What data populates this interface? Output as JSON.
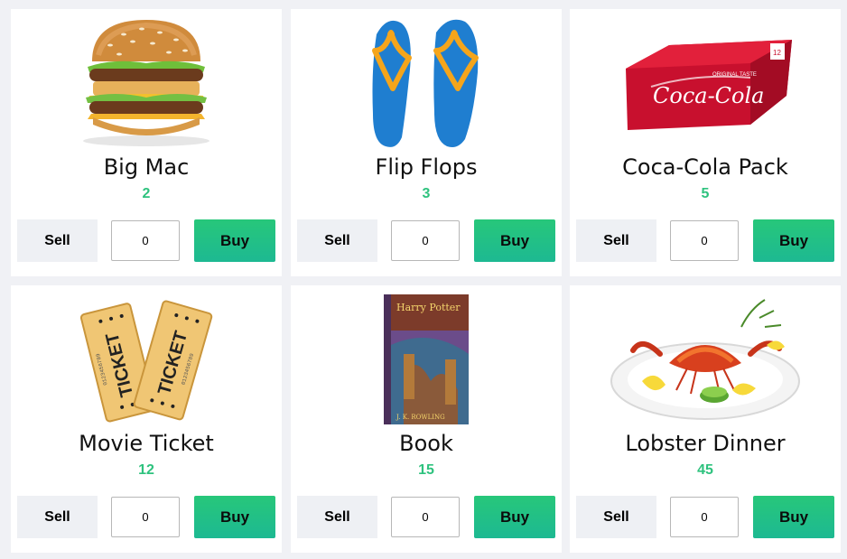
{
  "products": [
    {
      "name": "Big Mac",
      "price": "2",
      "sell_label": "Sell",
      "buy_label": "Buy",
      "quantity": "0"
    },
    {
      "name": "Flip Flops",
      "price": "3",
      "sell_label": "Sell",
      "buy_label": "Buy",
      "quantity": "0"
    },
    {
      "name": "Coca-Cola Pack",
      "price": "5",
      "sell_label": "Sell",
      "buy_label": "Buy",
      "quantity": "0"
    },
    {
      "name": "Movie Ticket",
      "price": "12",
      "sell_label": "Sell",
      "buy_label": "Buy",
      "quantity": "0"
    },
    {
      "name": "Book",
      "price": "15",
      "sell_label": "Sell",
      "buy_label": "Buy",
      "quantity": "0"
    },
    {
      "name": "Lobster Dinner",
      "price": "45",
      "sell_label": "Sell",
      "buy_label": "Buy",
      "quantity": "0"
    }
  ],
  "colors": {
    "background": "#f0f1f5",
    "card": "#ffffff",
    "price": "#2ec27e",
    "buy_button": "#23c283",
    "sell_button": "#eef0f4"
  },
  "images": {
    "coca_cola_brand": "Coca-Cola",
    "coca_cola_tagline": "ORIGINAL TASTE",
    "coca_cola_count": "12",
    "ticket_text": "TICKET",
    "ticket_serial": "0123456789",
    "book_title": "Harry Potter",
    "book_author": "J. K. ROWLING"
  }
}
